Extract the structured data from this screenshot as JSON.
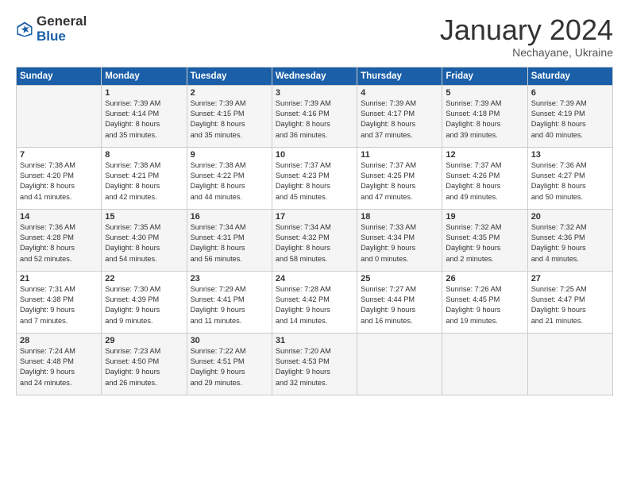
{
  "logo": {
    "general": "General",
    "blue": "Blue"
  },
  "title": "January 2024",
  "subtitle": "Nechayane, Ukraine",
  "days_header": [
    "Sunday",
    "Monday",
    "Tuesday",
    "Wednesday",
    "Thursday",
    "Friday",
    "Saturday"
  ],
  "weeks": [
    [
      {
        "day": "",
        "info": ""
      },
      {
        "day": "1",
        "info": "Sunrise: 7:39 AM\nSunset: 4:14 PM\nDaylight: 8 hours\nand 35 minutes."
      },
      {
        "day": "2",
        "info": "Sunrise: 7:39 AM\nSunset: 4:15 PM\nDaylight: 8 hours\nand 35 minutes."
      },
      {
        "day": "3",
        "info": "Sunrise: 7:39 AM\nSunset: 4:16 PM\nDaylight: 8 hours\nand 36 minutes."
      },
      {
        "day": "4",
        "info": "Sunrise: 7:39 AM\nSunset: 4:17 PM\nDaylight: 8 hours\nand 37 minutes."
      },
      {
        "day": "5",
        "info": "Sunrise: 7:39 AM\nSunset: 4:18 PM\nDaylight: 8 hours\nand 39 minutes."
      },
      {
        "day": "6",
        "info": "Sunrise: 7:39 AM\nSunset: 4:19 PM\nDaylight: 8 hours\nand 40 minutes."
      }
    ],
    [
      {
        "day": "7",
        "info": "Sunrise: 7:38 AM\nSunset: 4:20 PM\nDaylight: 8 hours\nand 41 minutes."
      },
      {
        "day": "8",
        "info": "Sunrise: 7:38 AM\nSunset: 4:21 PM\nDaylight: 8 hours\nand 42 minutes."
      },
      {
        "day": "9",
        "info": "Sunrise: 7:38 AM\nSunset: 4:22 PM\nDaylight: 8 hours\nand 44 minutes."
      },
      {
        "day": "10",
        "info": "Sunrise: 7:37 AM\nSunset: 4:23 PM\nDaylight: 8 hours\nand 45 minutes."
      },
      {
        "day": "11",
        "info": "Sunrise: 7:37 AM\nSunset: 4:25 PM\nDaylight: 8 hours\nand 47 minutes."
      },
      {
        "day": "12",
        "info": "Sunrise: 7:37 AM\nSunset: 4:26 PM\nDaylight: 8 hours\nand 49 minutes."
      },
      {
        "day": "13",
        "info": "Sunrise: 7:36 AM\nSunset: 4:27 PM\nDaylight: 8 hours\nand 50 minutes."
      }
    ],
    [
      {
        "day": "14",
        "info": "Sunrise: 7:36 AM\nSunset: 4:28 PM\nDaylight: 8 hours\nand 52 minutes."
      },
      {
        "day": "15",
        "info": "Sunrise: 7:35 AM\nSunset: 4:30 PM\nDaylight: 8 hours\nand 54 minutes."
      },
      {
        "day": "16",
        "info": "Sunrise: 7:34 AM\nSunset: 4:31 PM\nDaylight: 8 hours\nand 56 minutes."
      },
      {
        "day": "17",
        "info": "Sunrise: 7:34 AM\nSunset: 4:32 PM\nDaylight: 8 hours\nand 58 minutes."
      },
      {
        "day": "18",
        "info": "Sunrise: 7:33 AM\nSunset: 4:34 PM\nDaylight: 9 hours\nand 0 minutes."
      },
      {
        "day": "19",
        "info": "Sunrise: 7:32 AM\nSunset: 4:35 PM\nDaylight: 9 hours\nand 2 minutes."
      },
      {
        "day": "20",
        "info": "Sunrise: 7:32 AM\nSunset: 4:36 PM\nDaylight: 9 hours\nand 4 minutes."
      }
    ],
    [
      {
        "day": "21",
        "info": "Sunrise: 7:31 AM\nSunset: 4:38 PM\nDaylight: 9 hours\nand 7 minutes."
      },
      {
        "day": "22",
        "info": "Sunrise: 7:30 AM\nSunset: 4:39 PM\nDaylight: 9 hours\nand 9 minutes."
      },
      {
        "day": "23",
        "info": "Sunrise: 7:29 AM\nSunset: 4:41 PM\nDaylight: 9 hours\nand 11 minutes."
      },
      {
        "day": "24",
        "info": "Sunrise: 7:28 AM\nSunset: 4:42 PM\nDaylight: 9 hours\nand 14 minutes."
      },
      {
        "day": "25",
        "info": "Sunrise: 7:27 AM\nSunset: 4:44 PM\nDaylight: 9 hours\nand 16 minutes."
      },
      {
        "day": "26",
        "info": "Sunrise: 7:26 AM\nSunset: 4:45 PM\nDaylight: 9 hours\nand 19 minutes."
      },
      {
        "day": "27",
        "info": "Sunrise: 7:25 AM\nSunset: 4:47 PM\nDaylight: 9 hours\nand 21 minutes."
      }
    ],
    [
      {
        "day": "28",
        "info": "Sunrise: 7:24 AM\nSunset: 4:48 PM\nDaylight: 9 hours\nand 24 minutes."
      },
      {
        "day": "29",
        "info": "Sunrise: 7:23 AM\nSunset: 4:50 PM\nDaylight: 9 hours\nand 26 minutes."
      },
      {
        "day": "30",
        "info": "Sunrise: 7:22 AM\nSunset: 4:51 PM\nDaylight: 9 hours\nand 29 minutes."
      },
      {
        "day": "31",
        "info": "Sunrise: 7:20 AM\nSunset: 4:53 PM\nDaylight: 9 hours\nand 32 minutes."
      },
      {
        "day": "",
        "info": ""
      },
      {
        "day": "",
        "info": ""
      },
      {
        "day": "",
        "info": ""
      }
    ]
  ]
}
